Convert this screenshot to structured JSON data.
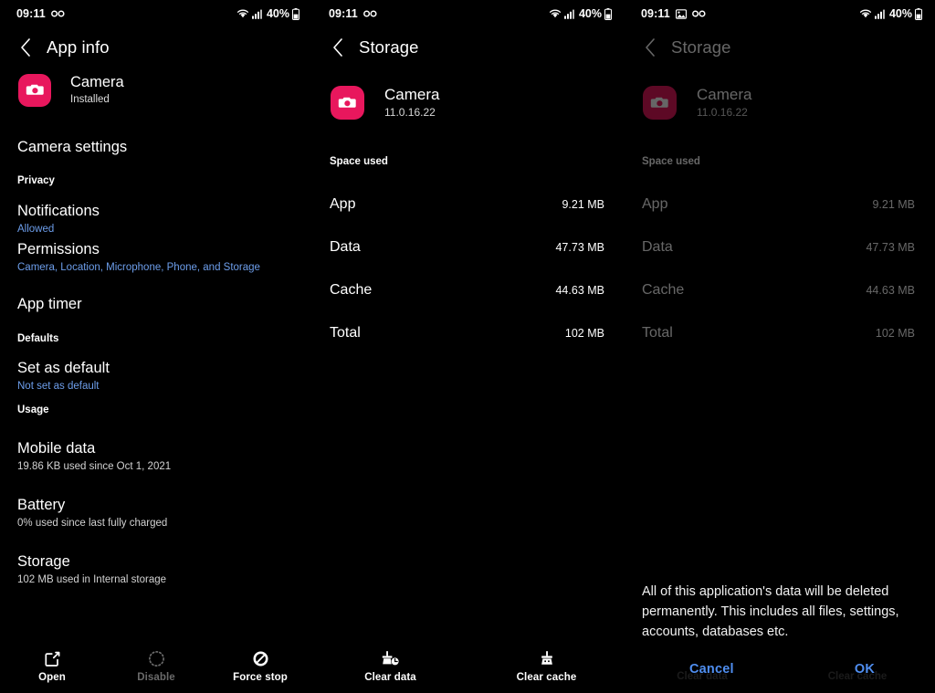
{
  "statusbar": {
    "time": "09:11",
    "battery_percent": "40%",
    "icons_left_p1": [
      "infinity-icon"
    ],
    "icons_left_p2": [
      "infinity-icon"
    ],
    "icons_left_p3": [
      "image-icon",
      "infinity-icon"
    ],
    "icons_right": [
      "wifi-icon",
      "signal-icon",
      "battery-icon"
    ]
  },
  "panel1": {
    "appbar_title": "App info",
    "back_icon": "back-chevron-icon",
    "app": {
      "icon": "camera-app-icon",
      "name": "Camera",
      "status": "Installed",
      "icon_color": "#e8175d"
    },
    "rows": [
      {
        "type": "item",
        "title": "Camera settings"
      },
      {
        "type": "section",
        "title": "Privacy"
      },
      {
        "type": "item",
        "title": "Notifications",
        "sub": "Allowed"
      },
      {
        "type": "item",
        "title": "Permissions",
        "sub": "Camera, Location, Microphone, Phone, and Storage"
      },
      {
        "type": "item",
        "title": "App timer"
      },
      {
        "type": "section",
        "title": "Defaults"
      },
      {
        "type": "item",
        "title": "Set as default",
        "sub": "Not set as default"
      },
      {
        "type": "section",
        "title": "Usage"
      },
      {
        "type": "item",
        "title": "Mobile data",
        "sub": "19.86 KB used since Oct 1, 2021",
        "sub_neutral": true
      },
      {
        "type": "item",
        "title": "Battery",
        "sub": "0% used since last fully charged",
        "sub_neutral": true
      },
      {
        "type": "item",
        "title": "Storage",
        "sub": "102 MB used in Internal storage",
        "sub_neutral": true
      }
    ],
    "actions": [
      {
        "label": "Open",
        "icon": "external-link-icon",
        "disabled": false
      },
      {
        "label": "Disable",
        "icon": "dotted-circle-icon",
        "disabled": true
      },
      {
        "label": "Force stop",
        "icon": "prohibition-icon",
        "disabled": false
      }
    ]
  },
  "panel2": {
    "appbar_title": "Storage",
    "back_icon": "back-chevron-icon",
    "app": {
      "icon": "camera-app-icon",
      "name": "Camera",
      "version": "11.0.16.22",
      "icon_color": "#e8175d"
    },
    "section_title": "Space used",
    "storage_rows": [
      {
        "label": "App",
        "value": "9.21 MB"
      },
      {
        "label": "Data",
        "value": "47.73 MB"
      },
      {
        "label": "Cache",
        "value": "44.63 MB"
      },
      {
        "label": "Total",
        "value": "102 MB"
      }
    ],
    "actions": [
      {
        "label": "Clear data",
        "icon": "broom-clock-icon"
      },
      {
        "label": "Clear cache",
        "icon": "broom-icon"
      }
    ]
  },
  "panel3": {
    "appbar_title": "Storage",
    "back_icon": "back-chevron-icon",
    "app": {
      "icon": "camera-app-icon",
      "name": "Camera",
      "version": "11.0.16.22",
      "icon_color": "#8c1338"
    },
    "section_title": "Space used",
    "storage_rows": [
      {
        "label": "App",
        "value": "9.21 MB"
      },
      {
        "label": "Data",
        "value": "47.73 MB"
      },
      {
        "label": "Cache",
        "value": "44.63 MB"
      },
      {
        "label": "Total",
        "value": "102 MB"
      }
    ],
    "dialog": {
      "message": "All of this application's data will be deleted permanently. This includes all files, settings, accounts, databases etc.",
      "cancel_label": "Cancel",
      "ok_label": "OK",
      "button_color": "#4f8ef0"
    },
    "ghost_actions": [
      {
        "label": "Clear data"
      },
      {
        "label": "Clear cache"
      }
    ]
  }
}
